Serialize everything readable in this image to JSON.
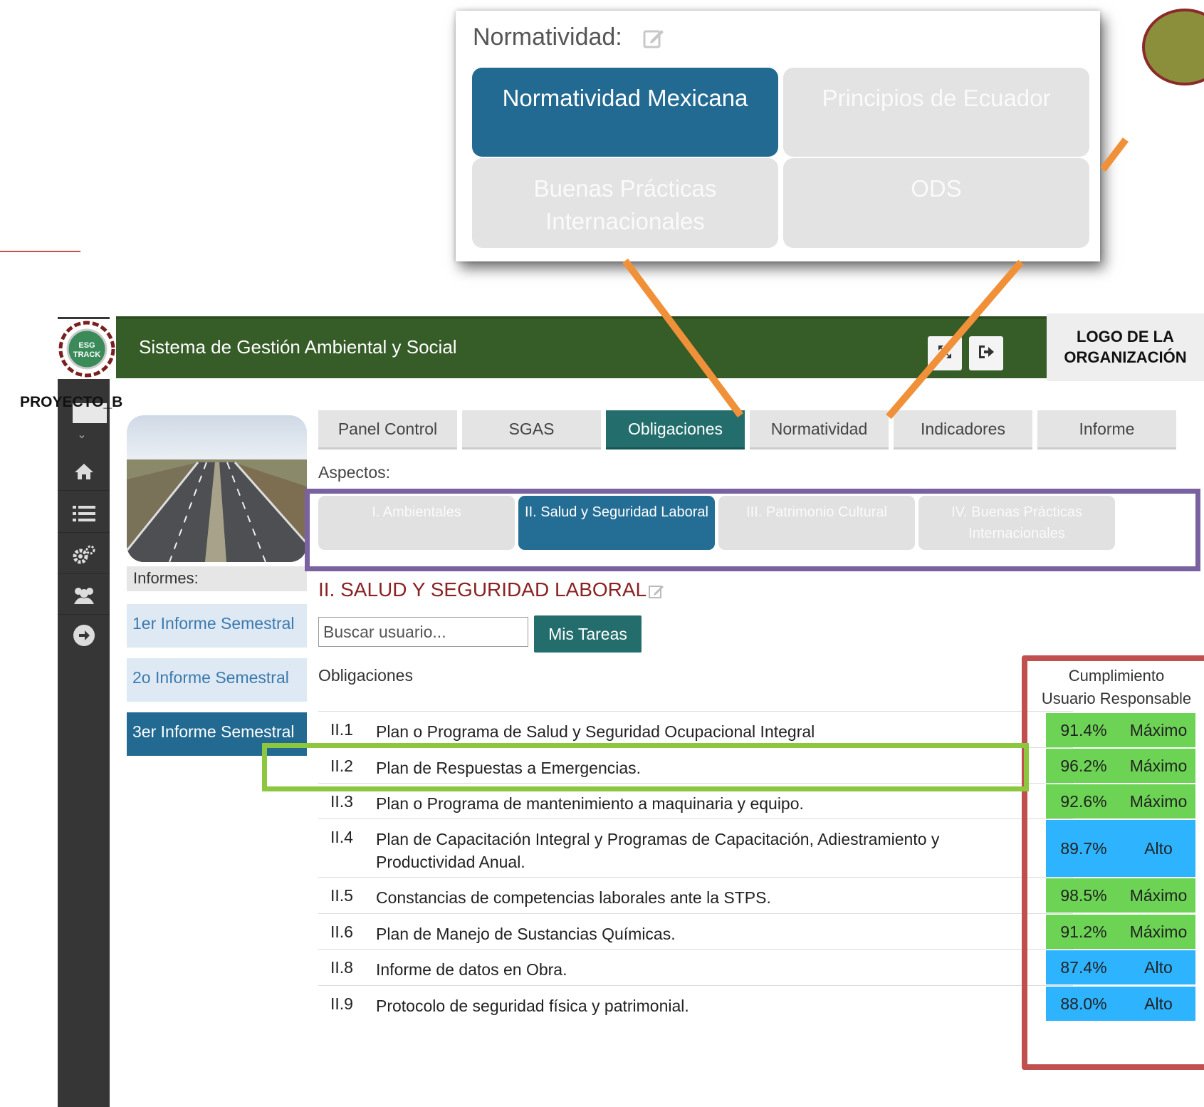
{
  "popup": {
    "title": "Normatividad:",
    "edit_icon": "edit-icon",
    "cards": [
      {
        "label": "Normatividad Mexicana",
        "active": true
      },
      {
        "label": "Principios de Ecuador",
        "active": false
      },
      {
        "label": "Buenas Prácticas Internacionales",
        "active": false
      },
      {
        "label": "ODS",
        "active": false
      }
    ]
  },
  "header": {
    "title": "Sistema de Gestión Ambiental y Social",
    "logo_text": "ESG TRACK",
    "org_logo": "LOGO DE LA ORGANIZACIÓN",
    "buttons": [
      "expand-icon",
      "logout-icon"
    ],
    "color": "#365c28"
  },
  "project_label": "PROYECTO_B",
  "sidebar": {
    "icons": [
      "chevron-down-icon",
      "home-icon",
      "list-icon",
      "gears-icon",
      "users-icon",
      "arrow-right-circle-icon"
    ]
  },
  "informes": {
    "label": "Informes:",
    "items": [
      {
        "label": "1er Informe Semestral",
        "active": false
      },
      {
        "label": "2o Informe Semestral",
        "active": false
      },
      {
        "label": "3er Informe Semestral",
        "active": true
      }
    ]
  },
  "tabs": [
    {
      "label": "Panel Control",
      "active": false
    },
    {
      "label": "SGAS",
      "active": false
    },
    {
      "label": "Obligaciones",
      "active": true
    },
    {
      "label": "Normatividad",
      "active": false
    },
    {
      "label": "Indicadores",
      "active": false
    },
    {
      "label": "Informe",
      "active": false
    }
  ],
  "aspectos": {
    "label": "Aspectos:",
    "items": [
      {
        "label": "I. Ambientales",
        "active": false
      },
      {
        "label": "II. Salud y Seguridad Laboral",
        "active": true
      },
      {
        "label": "III. Patrimonio Cultural",
        "active": false
      },
      {
        "label": "IV. Buenas Prácticas Internacionales",
        "active": false
      }
    ]
  },
  "section_title": "II. SALUD Y SEGURIDAD LABORAL",
  "search": {
    "placeholder": "Buscar usuario..."
  },
  "mis_tareas": "Mis Tareas",
  "table": {
    "header_left": "Obligaciones",
    "header_right_1": "Cumplimiento",
    "header_right_2": "Usuario Responsable",
    "rows": [
      {
        "num": "II.1",
        "text": "Plan o Programa de Salud y Seguridad Ocupacional Integral",
        "pct": "91.4%",
        "level": "Máximo"
      },
      {
        "num": "II.2",
        "text": "Plan de Respuestas a Emergencias.",
        "pct": "96.2%",
        "level": "Máximo"
      },
      {
        "num": "II.3",
        "text": "Plan o Programa de mantenimiento a maquinaria y equipo.",
        "pct": "92.6%",
        "level": "Máximo"
      },
      {
        "num": "II.4",
        "text": "Plan de Capacitación Integral y Programas de Capacitación, Adiestramiento y Productividad Anual.",
        "pct": "89.7%",
        "level": "Alto"
      },
      {
        "num": "II.5",
        "text": "Constancias de competencias laborales ante la STPS.",
        "pct": "98.5%",
        "level": "Máximo"
      },
      {
        "num": "II.6",
        "text": "Plan de Manejo de Sustancias Químicas.",
        "pct": "91.2%",
        "level": "Máximo"
      },
      {
        "num": "II.8",
        "text": "Informe de datos en Obra.",
        "pct": "87.4%",
        "level": "Alto"
      },
      {
        "num": "II.9",
        "text": "Protocolo de seguridad física y patrimonial.",
        "pct": "88.0%",
        "level": "Alto"
      }
    ]
  },
  "colors": {
    "accent_blue": "#236a92",
    "accent_teal": "#246d6d",
    "maximo": "#6cd354",
    "alto": "#2eb3ff",
    "highlight_red": "#c0504d",
    "highlight_green": "#8dc63f",
    "highlight_purple": "#7a62a0",
    "arrow_orange": "#f0913a"
  }
}
